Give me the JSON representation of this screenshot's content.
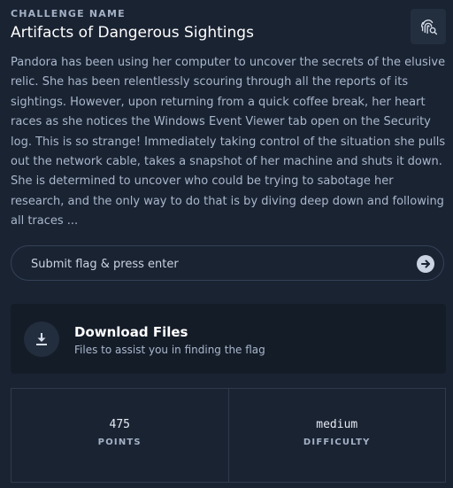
{
  "challenge": {
    "label": "CHALLENGE NAME",
    "title": "Artifacts of Dangerous Sightings",
    "description": "Pandora has been using her computer to uncover the secrets of the elusive relic. She has been relentlessly scouring through all the reports of its sightings. However, upon returning from a quick coffee break, her heart races as she notices the Windows Event Viewer tab open on the Security log. This is so strange! Immediately taking control of the situation she pulls out the network cable, takes a snapshot of her machine and shuts it down. She is determined to uncover who could be trying to sabotage her research, and the only way to do that is by diving deep down and following all traces ..."
  },
  "flag_input": {
    "placeholder": "Submit flag & press enter",
    "value": ""
  },
  "download": {
    "title": "Download Files",
    "subtitle": "Files to assist you in finding the flag"
  },
  "stats": {
    "points_value": "475",
    "points_label": "POINTS",
    "difficulty_value": "medium",
    "difficulty_label": "DIFFICULTY"
  },
  "icons": {
    "fingerprint": "fingerprint-search-icon",
    "submit": "arrow-right-circle-icon",
    "download": "download-icon"
  }
}
